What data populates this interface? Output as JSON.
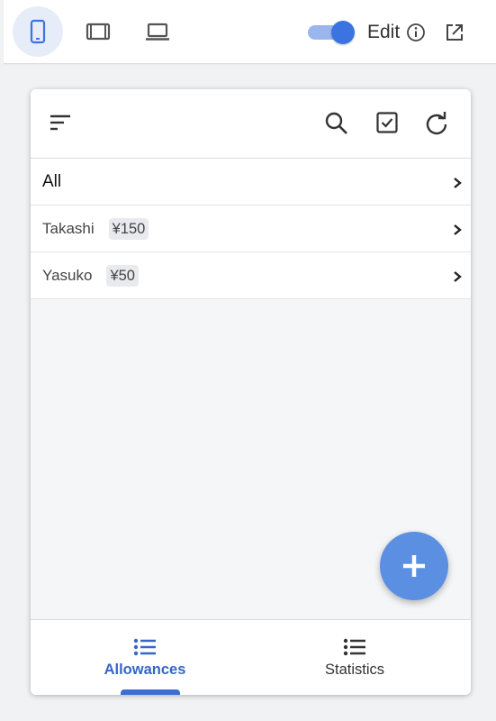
{
  "toolbar": {
    "devices": [
      {
        "name": "phone",
        "icon": "phone-icon",
        "active": true
      },
      {
        "name": "tablet",
        "icon": "tablet-icon",
        "active": false
      },
      {
        "name": "laptop",
        "icon": "laptop-icon",
        "active": false
      }
    ],
    "edit_toggle_on": true,
    "edit_label": "Edit",
    "info_icon": "info-icon",
    "open_icon": "open-external-icon"
  },
  "app": {
    "header_icons": [
      "sort-icon",
      "search-icon",
      "checkbox-icon",
      "refresh-icon"
    ],
    "rows": [
      {
        "name": "All",
        "amount": ""
      },
      {
        "name": "Takashi",
        "amount": "¥150"
      },
      {
        "name": "Yasuko",
        "amount": "¥50"
      }
    ],
    "fab_icon": "plus-icon",
    "nav": [
      {
        "label": "Allowances",
        "icon": "list-icon",
        "active": true
      },
      {
        "label": "Statistics",
        "icon": "list-icon",
        "active": false
      }
    ]
  },
  "colors": {
    "accent": "#3b74e0",
    "fab": "#5b8fe2",
    "active_nav": "#3566c6"
  }
}
